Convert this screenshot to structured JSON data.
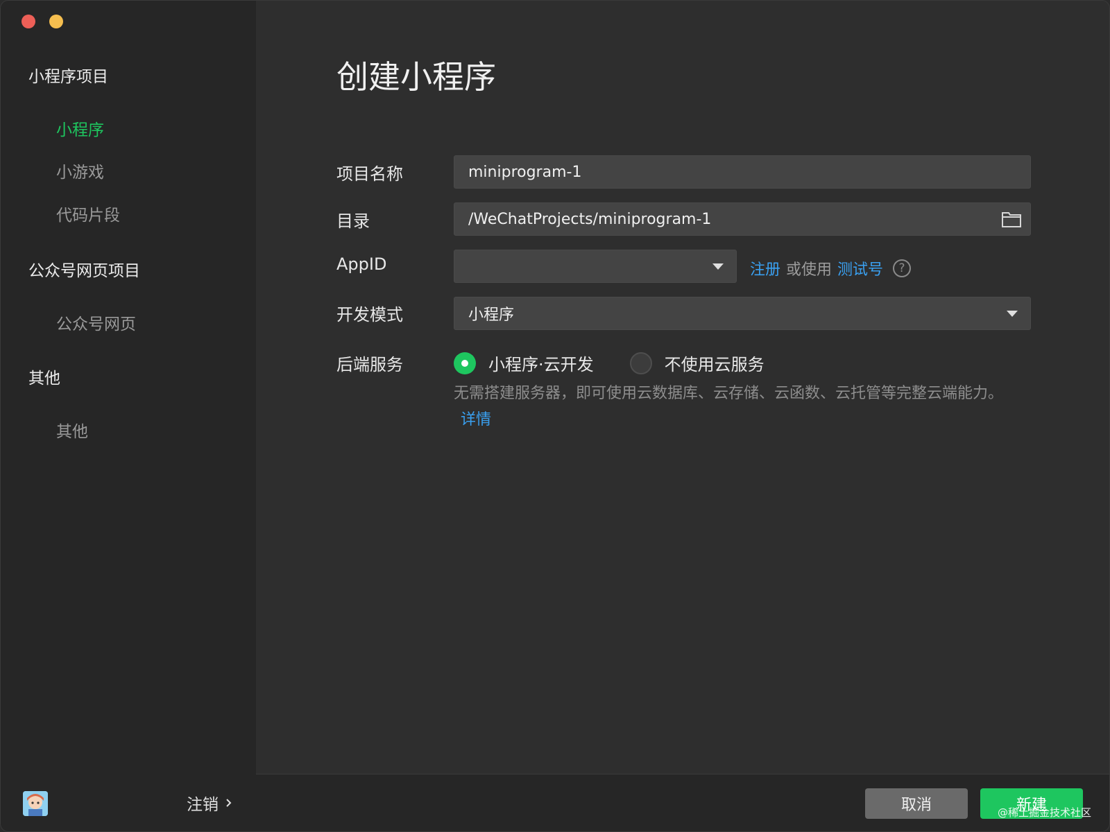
{
  "sidebar": {
    "groups": [
      {
        "title": "小程序项目",
        "items": [
          "小程序",
          "小游戏",
          "代码片段"
        ]
      },
      {
        "title": "公众号网页项目",
        "items": [
          "公众号网页"
        ]
      },
      {
        "title": "其他",
        "items": [
          "其他"
        ]
      }
    ],
    "active_item": "小程序",
    "logout_label": "注销"
  },
  "main": {
    "title": "创建小程序",
    "form": {
      "project_name_label": "项目名称",
      "project_name_value": "miniprogram-1",
      "directory_label": "目录",
      "directory_value": "/WeChatProjects/miniprogram-1",
      "appid_label": "AppID",
      "appid_value": "",
      "appid_register": "注册",
      "appid_or_use": "或使用",
      "appid_test": "测试号",
      "help_glyph": "?",
      "mode_label": "开发模式",
      "mode_value": "小程序",
      "backend_label": "后端服务",
      "backend_option_cloud": "小程序·云开发",
      "backend_option_none": "不使用云服务",
      "backend_selected": "小程序·云开发",
      "description": "无需搭建服务器，即可使用云数据库、云存储、云函数、云托管等完整云端能力。",
      "details_link": "详情"
    }
  },
  "footer": {
    "cancel_label": "取消",
    "create_label": "新建",
    "watermark": "@稀土掘金技术社区"
  },
  "colors": {
    "accent_green": "#1ec65f",
    "link_blue": "#3aa0f0",
    "bg_main": "#2e2e2e",
    "bg_sidebar": "#262626"
  },
  "icons": [
    "close-dot",
    "minimize-dot",
    "folder-icon",
    "caret-down-icon",
    "help-icon",
    "chevron-right-icon",
    "avatar"
  ]
}
